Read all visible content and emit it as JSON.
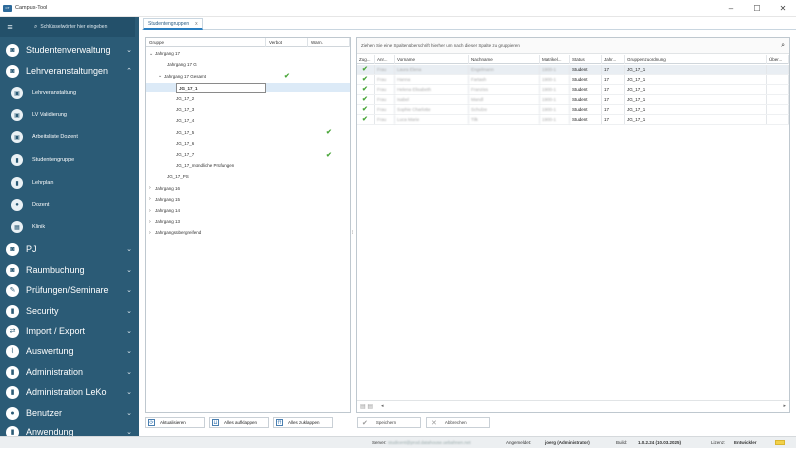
{
  "window": {
    "title": "Campus-Tool",
    "app_icon_text": "CT",
    "minimize": "–",
    "maximize": "☐",
    "close": "✕"
  },
  "sidebar": {
    "search_placeholder": "Schlüsselwörter hier eingeben",
    "items": [
      {
        "label": "Studentenverwaltung",
        "icon": "users-icon",
        "glyph": "◙",
        "chevron": "⌄",
        "level": 1
      },
      {
        "label": "Lehrveranstaltungen",
        "icon": "calendar-icon",
        "glyph": "◙",
        "chevron": "⌃",
        "level": 1
      },
      {
        "label": "Lehrveranstaltung",
        "icon": "calendar-icon",
        "glyph": "▣",
        "level": 2
      },
      {
        "label": "LV Validierung",
        "icon": "calendar-icon",
        "glyph": "▣",
        "level": 2
      },
      {
        "label": "Arbeitsliste Dozent",
        "icon": "calendar-icon",
        "glyph": "▣",
        "level": 2
      },
      {
        "label": "Studentengruppe",
        "icon": "person-icon",
        "glyph": "▮",
        "level": 2
      },
      {
        "label": "Lehrplan",
        "icon": "person-icon",
        "glyph": "▮",
        "level": 2
      },
      {
        "label": "Dozent",
        "icon": "person-icon",
        "glyph": "●",
        "level": 2
      },
      {
        "label": "Klinik",
        "icon": "building-icon",
        "glyph": "▦",
        "level": 2
      },
      {
        "label": "PJ",
        "icon": "calendar-icon",
        "glyph": "◙",
        "chevron": "⌄",
        "level": 1
      },
      {
        "label": "Raumbuchung",
        "icon": "calendar-icon",
        "glyph": "◙",
        "chevron": "⌄",
        "level": 1
      },
      {
        "label": "Prüfungen/Seminare",
        "icon": "pencil-icon",
        "glyph": "✎",
        "chevron": "⌄",
        "level": 1
      },
      {
        "label": "Security",
        "icon": "lock-icon",
        "glyph": "▮",
        "chevron": "⌄",
        "level": 1
      },
      {
        "label": "Import / Export",
        "icon": "transfer-icon",
        "glyph": "⇄",
        "chevron": "⌄",
        "level": 1
      },
      {
        "label": "Auswertung",
        "icon": "chart-icon",
        "glyph": "⌇",
        "chevron": "⌄",
        "level": 1
      },
      {
        "label": "Administration",
        "icon": "person-icon",
        "glyph": "▮",
        "chevron": "⌄",
        "level": 1
      },
      {
        "label": "Administration LeKo",
        "icon": "person-icon",
        "glyph": "▮",
        "chevron": "⌄",
        "level": 1
      },
      {
        "label": "Benutzer",
        "icon": "user-icon",
        "glyph": "●",
        "chevron": "⌄",
        "level": 1
      },
      {
        "label": "Anwendung",
        "icon": "app-icon",
        "glyph": "▮",
        "chevron": "⌄",
        "level": 1
      }
    ]
  },
  "tab": {
    "label": "Studentengruppen",
    "close": "x"
  },
  "tree": {
    "columns": [
      "Gruppe",
      "Verbot",
      "Warn."
    ],
    "rows": [
      {
        "arrow": "⌄",
        "label": "Jahrgang 17",
        "indent": 0,
        "check": ""
      },
      {
        "arrow": "",
        "label": "Jahrgang 17 G",
        "indent": 2,
        "check": ""
      },
      {
        "arrow": "⌄",
        "label": "Jahrgang 17 Gesamt",
        "indent": 1,
        "check": "✔"
      },
      {
        "arrow": "",
        "label": "JG_17_1",
        "indent": 3,
        "check": "",
        "selected": true
      },
      {
        "arrow": "",
        "label": "JG_17_2",
        "indent": 3,
        "check": ""
      },
      {
        "arrow": "",
        "label": "JG_17_3",
        "indent": 3,
        "check": ""
      },
      {
        "arrow": "",
        "label": "JG_17_4",
        "indent": 3,
        "check": ""
      },
      {
        "arrow": "",
        "label": "JG_17_5",
        "indent": 3,
        "check": "✔",
        "checkcol": 2
      },
      {
        "arrow": "",
        "label": "JG_17_6",
        "indent": 3,
        "check": ""
      },
      {
        "arrow": "",
        "label": "JG_17_7",
        "indent": 3,
        "check": "✔",
        "checkcol": 2
      },
      {
        "arrow": "",
        "label": "JG_17_mündliche Prüfungen",
        "indent": 3,
        "check": ""
      },
      {
        "arrow": "",
        "label": "JG_17_PS",
        "indent": 2,
        "check": ""
      },
      {
        "arrow": "›",
        "label": "Jahrgang 16",
        "indent": 0,
        "check": ""
      },
      {
        "arrow": "›",
        "label": "Jahrgang 15",
        "indent": 0,
        "check": ""
      },
      {
        "arrow": "›",
        "label": "Jahrgang 14",
        "indent": 0,
        "check": ""
      },
      {
        "arrow": "›",
        "label": "Jahrgang 13",
        "indent": 0,
        "check": ""
      },
      {
        "arrow": "›",
        "label": "Jahrgangsübergreifend",
        "indent": 0,
        "check": ""
      }
    ]
  },
  "left_buttons": [
    {
      "label": "Aktualisieren",
      "icon": "refresh-icon",
      "glyph": "⟳"
    },
    {
      "label": "Alles aufklappen",
      "icon": "expand-icon",
      "glyph": "⇊"
    },
    {
      "label": "Alles zuklappen",
      "icon": "collapse-icon",
      "glyph": "⇈"
    }
  ],
  "grid": {
    "group_hint": "Ziehen Sie eine Spaltenüberschrift hierher um nach dieser Spalte zu gruppieren",
    "columns": [
      "Zug...",
      "Anr...",
      "Vorname",
      "Nachname",
      "Matrikel...",
      "Status",
      "Jahr...",
      "Gruppenzuordnung",
      "Über..."
    ],
    "rows": [
      {
        "check": "✔",
        "anrede": "Frau",
        "vorname": "Laura Elena",
        "nachname": "Engelmann",
        "matrikel": "1900-1",
        "status": "Student",
        "jahr": "17",
        "gruppe": "JG_17_1"
      },
      {
        "check": "✔",
        "anrede": "Frau",
        "vorname": "Hanna",
        "nachname": "Fartash",
        "matrikel": "1900-1",
        "status": "Student",
        "jahr": "17",
        "gruppe": "JG_17_1"
      },
      {
        "check": "✔",
        "anrede": "Frau",
        "vorname": "Helena Elisabeth",
        "nachname": "Franziss",
        "matrikel": "1900-1",
        "status": "Student",
        "jahr": "17",
        "gruppe": "JG_17_1"
      },
      {
        "check": "✔",
        "anrede": "Frau",
        "vorname": "Isabel",
        "nachname": "Mandl",
        "matrikel": "1900-1",
        "status": "Student",
        "jahr": "17",
        "gruppe": "JG_17_1"
      },
      {
        "check": "✔",
        "anrede": "Frau",
        "vorname": "Sophie Charlotte",
        "nachname": "Schulze",
        "matrikel": "1900-1",
        "status": "Student",
        "jahr": "17",
        "gruppe": "JG_17_1"
      },
      {
        "check": "✔",
        "anrede": "Frau",
        "vorname": "Luca Marie",
        "nachname": "Tilk",
        "matrikel": "1900-1",
        "status": "Student",
        "jahr": "17",
        "gruppe": "JG_17_1"
      }
    ],
    "footer_left": "◂",
    "footer_right": "▸"
  },
  "right_buttons": [
    {
      "label": "Speichern",
      "icon": "check-icon",
      "glyph": "✔"
    },
    {
      "label": "Abbrechen",
      "icon": "x-icon",
      "glyph": "✕"
    }
  ],
  "status": {
    "server_label": "Server:",
    "server_value": "studicent@prod.datahouse.uebahnen.net",
    "user_label": "Angemeldet:",
    "user_value": "joerg (Administrator)",
    "build_label": "Build:",
    "build_value": "1.0.2.24 (10.03.2025)",
    "license_label": "Lizenz:",
    "license_value": "Entwickler",
    "accent": "#f2d14a"
  }
}
